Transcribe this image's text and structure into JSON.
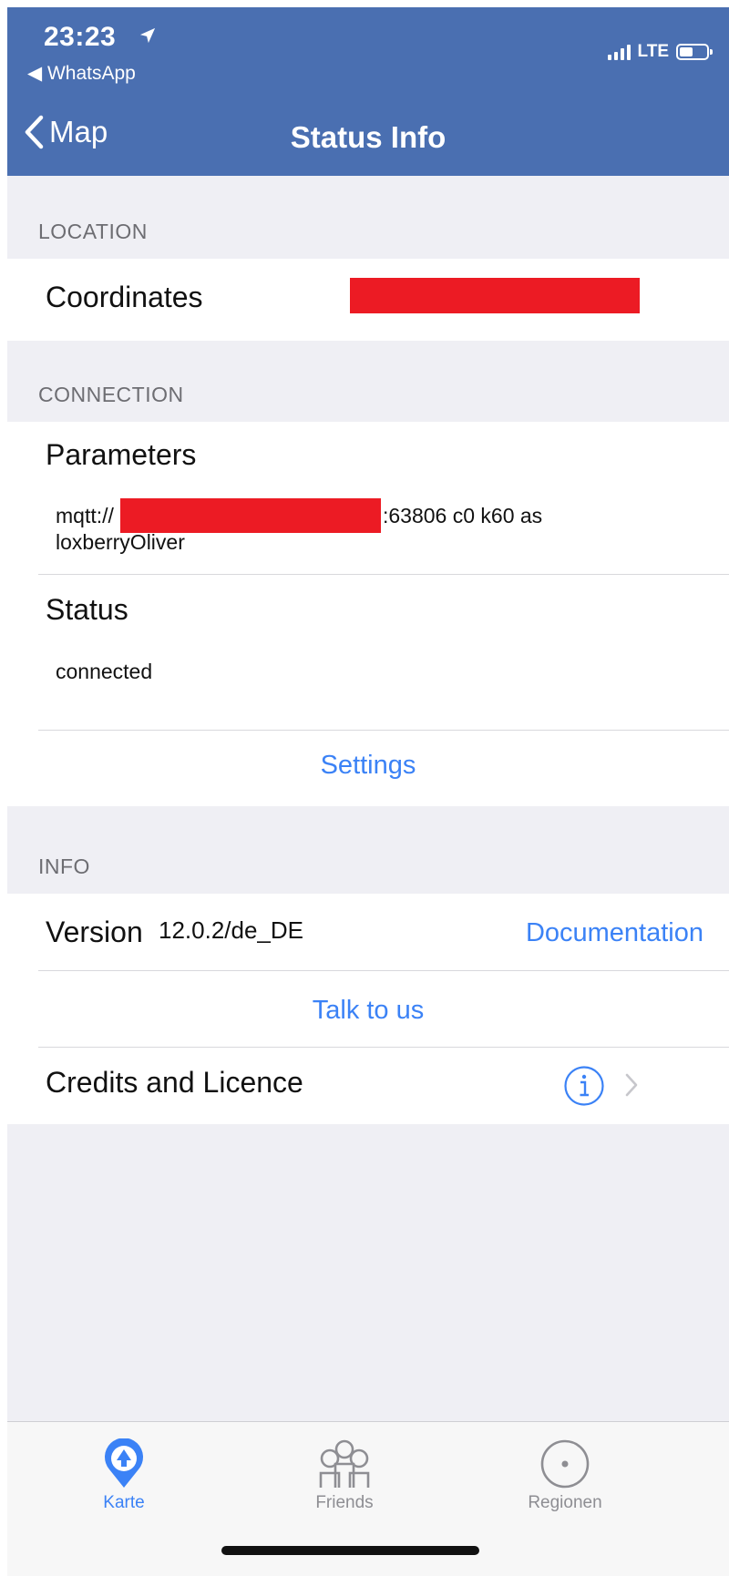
{
  "status_bar": {
    "time": "23:23",
    "back_app": "◀ WhatsApp",
    "network": "LTE"
  },
  "nav": {
    "back_label": "Map",
    "title": "Status Info"
  },
  "location": {
    "header": "LOCATION",
    "coordinates_label": "Coordinates"
  },
  "connection": {
    "header": "CONNECTION",
    "parameters_label": "Parameters",
    "parameters_prefix": "mqtt://",
    "parameters_suffix": ":63806 c0 k60 as",
    "parameters_line2": "loxberryOliver",
    "status_label": "Status",
    "status_value": "connected",
    "settings_link": "Settings"
  },
  "info": {
    "header": "INFO",
    "version_label": "Version",
    "version_value": "12.0.2/de_DE",
    "documentation_link": "Documentation",
    "talk_link": "Talk to us",
    "credits_label": "Credits and Licence"
  },
  "tabbar": {
    "tabs": [
      {
        "label": "Karte",
        "icon": "location-pin-icon",
        "active": true
      },
      {
        "label": "Friends",
        "icon": "friends-icon",
        "active": false
      },
      {
        "label": "Regionen",
        "icon": "region-icon",
        "active": false
      }
    ]
  },
  "colors": {
    "header_bg": "#4a6fb1",
    "accent": "#3b82f6",
    "redaction": "#ec1b24",
    "inactive_tab": "#8e8e93"
  }
}
